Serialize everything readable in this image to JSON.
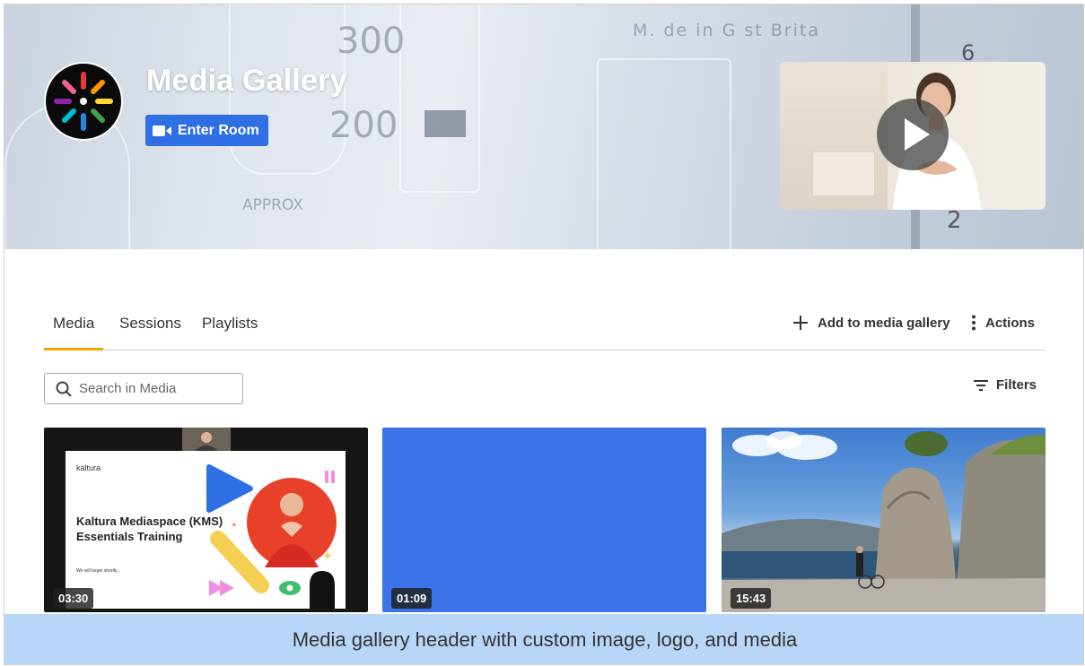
{
  "hero": {
    "title": "Media Gallery",
    "enter_room_label": "Enter Room",
    "logo_icon": "kaltura-burst-logo",
    "player_icon": "play-icon"
  },
  "tabs": [
    {
      "label": "Media",
      "active": true
    },
    {
      "label": "Sessions",
      "active": false
    },
    {
      "label": "Playlists",
      "active": false
    }
  ],
  "toolbar": {
    "add_label": "Add to media gallery",
    "actions_label": "Actions"
  },
  "search": {
    "placeholder": "Search in Media"
  },
  "filters_label": "Filters",
  "cards": [
    {
      "duration": "03:30",
      "slide_brand": "kaltura",
      "slide_title_line1": "Kaltura Mediaspace (KMS)",
      "slide_title_line2": "Essentials Training",
      "slide_sub": "We will begin shortly..."
    },
    {
      "duration": "01:09"
    },
    {
      "duration": "15:43"
    }
  ],
  "caption": "Media gallery header with custom image, logo, and media",
  "colors": {
    "accent_blue": "#2f6fe4",
    "tab_underline": "#f0a500",
    "caption_bg": "#b8d6f7",
    "card2_bg": "#3b73e9"
  }
}
